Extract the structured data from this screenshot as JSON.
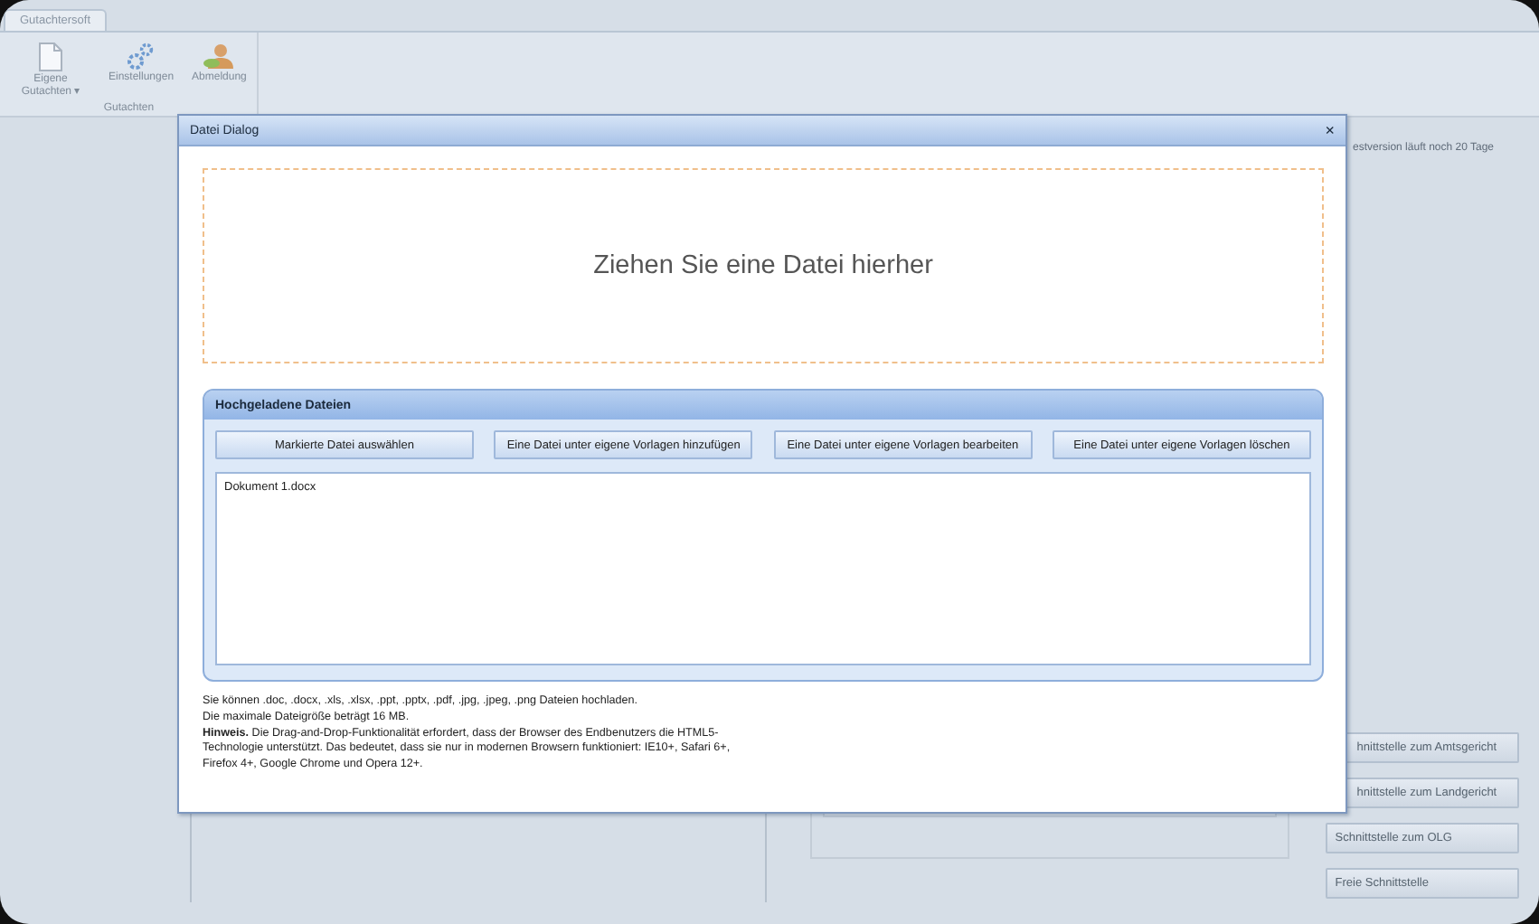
{
  "app": {
    "tab": "Gutachtersoft",
    "ribbon": {
      "buttons": [
        {
          "kind": "document",
          "label": "Eigene Gutachten",
          "dropdown": "▾"
        },
        {
          "kind": "gears",
          "label": "Einstellungen"
        },
        {
          "kind": "person",
          "label": "Abmeldung"
        }
      ],
      "group_label": "Gutachten"
    },
    "status": "estversion läuft noch 20 Tage",
    "interface_buttons": [
      "hnittstelle zum Amtsgericht",
      "hnittstelle zum Landgericht",
      "Schnittstelle zum OLG",
      "Freie Schnittstelle"
    ]
  },
  "dialog": {
    "title": "Datei Dialog",
    "close": "×",
    "dropzone": "Ziehen Sie eine Datei hierher",
    "uploaded": {
      "title": "Hochgeladene Dateien",
      "buttons": [
        "Markierte Datei auswählen",
        "Eine Datei unter eigene Vorlagen hinzufügen",
        "Eine Datei unter eigene Vorlagen bearbeiten",
        "Eine Datei unter eigene Vorlagen löschen"
      ],
      "files": [
        {
          "name": "Dokument 1.docx",
          "selected": false
        }
      ]
    },
    "notes": [
      "Sie können .doc, .docx, .xls, .xlsx, .ppt, .pptx, .pdf, .jpg, .jpeg, .png Dateien hochladen.",
      "Die maximale Dateigröße beträgt 16 MB.",
      "**Hinweis.** Die Drag-and-Drop-Funktionalität erfordert, dass der Browser des Endbenutzers die HTML5-Technologie unterstützt. Das bedeutet, dass sie nur in modernen Browsern funktioniert: IE10+, Safari 6+, Firefox 4+, Google Chrome und Opera 12+."
    ]
  }
}
